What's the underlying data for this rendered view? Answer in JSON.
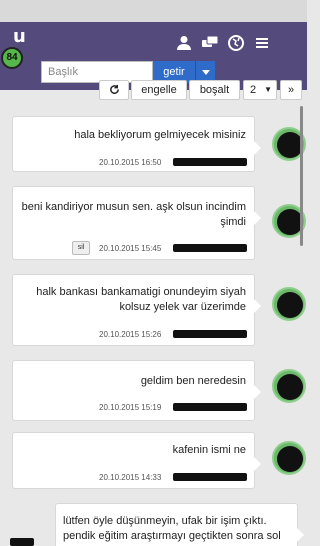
{
  "app": {
    "logo": "u",
    "notification_count": "84"
  },
  "search": {
    "placeholder": "Başlık",
    "button": "getir"
  },
  "toolbar": {
    "refresh_icon": "refresh-icon",
    "block": "engelle",
    "empty": "boşalt",
    "page": "2",
    "page_caret": "▼",
    "next": "»"
  },
  "messages": [
    {
      "text": "hala bekliyorum gelmiyecek misiniz",
      "date": "20.10.2015 16:50"
    },
    {
      "text": "beni kandiriyor musun sen. aşk olsun incindim şimdi",
      "date": "20.10.2015 15:45",
      "delete_label": "sil"
    },
    {
      "text": "halk bankası bankamatigi onundeyim siyah kolsuz yelek var üzerimde",
      "date": "20.10.2015 15:26"
    },
    {
      "text": "geldim ben neredesin",
      "date": "20.10.2015 15:19"
    },
    {
      "text": "kafenin ismi ne",
      "date": "20.10.2015 14:33"
    },
    {
      "text": "lütfen öyle düşünmeyin, ufak bir işim çıktı. pendik eğitim araştırmayı geçtikten sonra sol tarafta"
    }
  ]
}
